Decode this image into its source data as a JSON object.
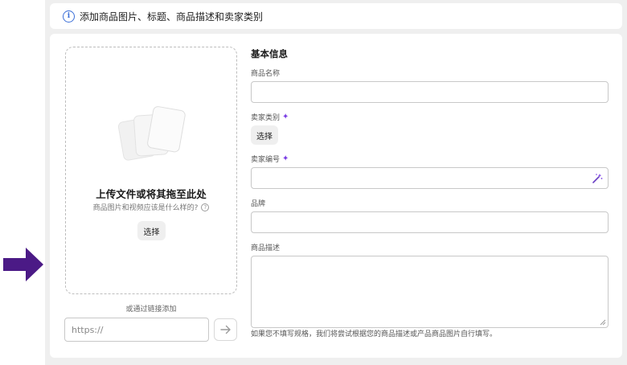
{
  "banner": {
    "text": "添加商品图片、标题、商品描述和卖家类别",
    "icon": "info-icon"
  },
  "upload": {
    "title": "上传文件或将其拖至此处",
    "help_text": "商品图片和视频应该是什么样的?",
    "help_icon": "question-circle-icon",
    "button_label": "选择",
    "url_label": "或通过链接添加",
    "url_placeholder": "https://",
    "url_submit_icon": "arrow-right-icon"
  },
  "basic_info": {
    "section_title": "基本信息",
    "product_name": {
      "label": "商品名称",
      "value": ""
    },
    "seller_category": {
      "label": "卖家类别",
      "button_label": "选择",
      "icon": "sparkle-icon"
    },
    "seller_sku": {
      "label": "卖家编号",
      "value": "",
      "icon": "sparkle-icon",
      "input_icon": "magic-wand-icon"
    },
    "brand": {
      "label": "品牌",
      "value": ""
    },
    "description": {
      "label": "商品描述",
      "value": ""
    },
    "footnote": "如果您不填写规格，我们将尝试根据您的商品描述或产品商品图片自行填写。"
  },
  "colors": {
    "accent": "#7b3fe4",
    "info": "#3b6fd8",
    "arrow": "#4b1a86",
    "canvas": "#efefef"
  }
}
